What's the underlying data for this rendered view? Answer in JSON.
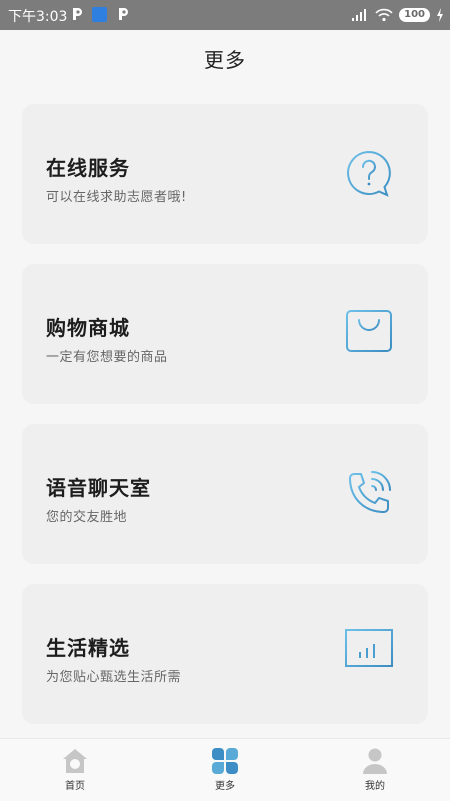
{
  "status_bar": {
    "time": "下午3:03",
    "battery": "100"
  },
  "header": {
    "title": "更多"
  },
  "cards": [
    {
      "title": "在线服务",
      "desc": "可以在线求助志愿者哦!",
      "icon": "help-chat-icon"
    },
    {
      "title": "购物商城",
      "desc": "一定有您想要的商品",
      "icon": "shopping-bag-icon"
    },
    {
      "title": "语音聊天室",
      "desc": "您的交友胜地",
      "icon": "phone-call-icon"
    },
    {
      "title": "生活精选",
      "desc": "为您贴心甄选生活所需",
      "icon": "monitor-chart-icon"
    }
  ],
  "nav": {
    "items": [
      {
        "label": "首页",
        "icon": "home-icon"
      },
      {
        "label": "更多",
        "icon": "more-icon"
      },
      {
        "label": "我的",
        "icon": "profile-icon"
      }
    ]
  },
  "colors": {
    "accent": "#4a9fd0",
    "card_bg": "#f0eff0",
    "page_bg": "#f7f6f7"
  }
}
